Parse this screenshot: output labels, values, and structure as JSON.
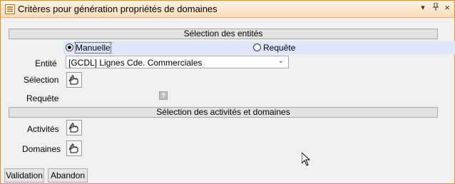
{
  "window": {
    "title": "Critères pour génération propriétés de domaines"
  },
  "titlebar_controls": {
    "dropdown_icon": "chevron-down",
    "pin_icon": "pin",
    "close_icon": "close"
  },
  "entity_section": {
    "header": "Sélection des entités",
    "mode_options": [
      {
        "label": "Manuelle",
        "checked": true
      },
      {
        "label": "Requête",
        "checked": false
      }
    ],
    "entity_label": "Entité",
    "entity_value": "[GCDL] Lignes Cde. Commerciales",
    "selection_label": "Sélection",
    "query_label": "Requête",
    "query_help": "?"
  },
  "activity_section": {
    "header": "Sélection des activités et domaines",
    "activities_label": "Activités",
    "domains_label": "Domaines"
  },
  "footer": {
    "validate_label": "Validation",
    "cancel_label": "Abandon"
  }
}
